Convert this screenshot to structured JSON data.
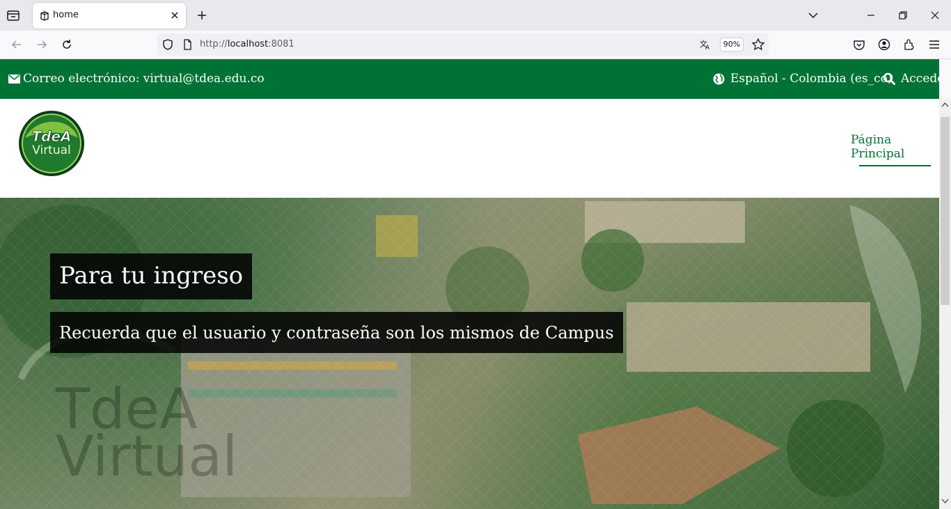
{
  "browser": {
    "tab_title": "home",
    "url_scheme": "http://",
    "url_host": "localhost",
    "url_port": ":8081",
    "zoom": "90%"
  },
  "topbar": {
    "email_label": "Correo electrónico: virtual@tdea.edu.co",
    "language": "Español - Colombia (es_co)",
    "login": "Acceder"
  },
  "header": {
    "logo_line1": "TdeA",
    "logo_line2": "Virtual",
    "menu_home": "Página Principal"
  },
  "hero": {
    "title": "Para tu ingreso",
    "subtitle": "Recuerda que el usuario y contraseña son los mismos de Campus",
    "watermark_line1": "TdeA",
    "watermark_line2": "Virtual"
  },
  "colors": {
    "brand_green": "#007236"
  }
}
